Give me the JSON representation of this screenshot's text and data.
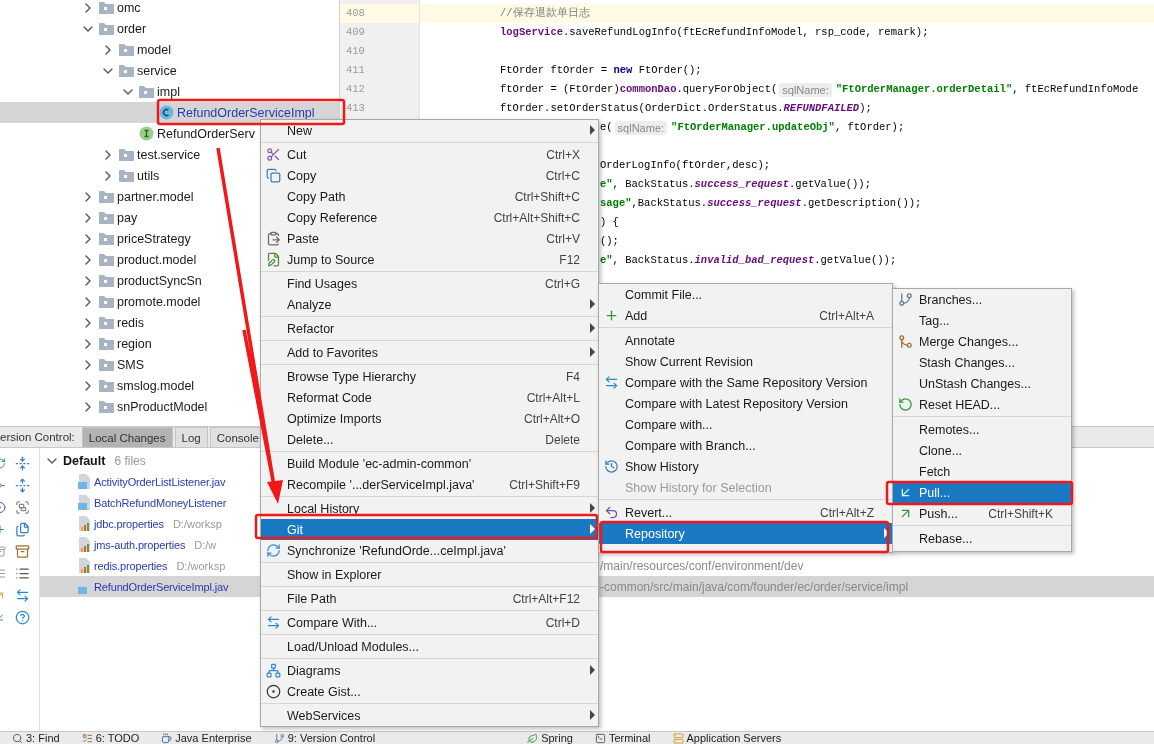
{
  "project_tree": {
    "items": [
      {
        "label": "omc",
        "kind": "folder",
        "expanded": false,
        "selected": false
      },
      {
        "label": "order",
        "kind": "folder",
        "expanded": true,
        "selected": false,
        "children": [
          {
            "label": "model",
            "kind": "folder",
            "expanded": false,
            "selected": false
          },
          {
            "label": "service",
            "kind": "folder",
            "expanded": true,
            "selected": false,
            "children": [
              {
                "label": "impl",
                "kind": "folder",
                "expanded": true,
                "selected": false,
                "children": [
                  {
                    "label": "RefundOrderServiceImpl",
                    "kind": "class",
                    "modified": true,
                    "selected": true
                  }
                ]
              },
              {
                "label": "RefundOrderServ",
                "kind": "interface",
                "modified": false,
                "selected": false
              }
            ]
          },
          {
            "label": "test.service",
            "kind": "folder",
            "expanded": false,
            "selected": false
          },
          {
            "label": "utils",
            "kind": "folder",
            "expanded": false,
            "selected": false
          }
        ]
      },
      {
        "label": "partner.model",
        "kind": "folder",
        "expanded": false,
        "selected": false
      },
      {
        "label": "pay",
        "kind": "folder",
        "expanded": false,
        "selected": false
      },
      {
        "label": "priceStrategy",
        "kind": "folder",
        "expanded": false,
        "selected": false
      },
      {
        "label": "product.model",
        "kind": "folder",
        "expanded": false,
        "selected": false
      },
      {
        "label": "productSyncSn",
        "kind": "folder",
        "expanded": false,
        "selected": false
      },
      {
        "label": "promote.model",
        "kind": "folder",
        "expanded": false,
        "selected": false
      },
      {
        "label": "redis",
        "kind": "folder",
        "expanded": false,
        "selected": false
      },
      {
        "label": "region",
        "kind": "folder",
        "expanded": false,
        "selected": false
      },
      {
        "label": "SMS",
        "kind": "folder",
        "expanded": false,
        "selected": false
      },
      {
        "label": "smslog.model",
        "kind": "folder",
        "expanded": false,
        "selected": false
      },
      {
        "label": "snProductModel",
        "kind": "folder",
        "expanded": false,
        "selected": false
      }
    ]
  },
  "editor": {
    "lines": [
      {
        "number": "408",
        "current": true,
        "tokens": [
          {
            "kind": "comment",
            "text": "//保存退款单日志"
          }
        ]
      },
      {
        "number": "409",
        "current": false,
        "tokens": [
          {
            "kind": "field",
            "text": "logService"
          },
          {
            "kind": "plain",
            "text": ".saveRefundLogInfo(ftEcRefundInfoModel, rsp_code, remark);"
          }
        ]
      },
      {
        "number": "410",
        "current": false
      },
      {
        "number": "411",
        "current": false,
        "tokens": [
          {
            "kind": "plain",
            "text": "FtOrder ftOrder = "
          },
          {
            "kind": "keyword",
            "text": "new"
          },
          {
            "kind": "plain",
            "text": " FtOrder();"
          }
        ]
      },
      {
        "number": "412",
        "current": false,
        "tokens": [
          {
            "kind": "plain",
            "text": "ftOrder = (FtOrder)"
          },
          {
            "kind": "field",
            "text": "commonDao"
          },
          {
            "kind": "plain",
            "text": ".queryForObject("
          },
          {
            "kind": "hint",
            "text": "sqlName:"
          },
          {
            "kind": "string",
            "text": "\"FtOrderManager.orderDetail\""
          },
          {
            "kind": "plain",
            "text": ", ftEcRefundInfoMode"
          }
        ]
      },
      {
        "number": "413",
        "current": false,
        "tokens": [
          {
            "kind": "plain",
            "text": "ftOrder.setOrderStatus(OrderDict.OrderStatus."
          },
          {
            "kind": "constant",
            "text": "REFUNDFAILED"
          },
          {
            "kind": "plain",
            "text": ");"
          }
        ]
      },
      {
        "current": false,
        "tokens": [
          {
            "kind": "plain",
            "text": "e("
          },
          {
            "kind": "hint",
            "text": "sqlName:"
          },
          {
            "kind": "string",
            "text": "\"FtOrderManager.updateObj\""
          },
          {
            "kind": "plain",
            "text": ", ftOrder);"
          }
        ]
      },
      {
        "current": false
      },
      {
        "current": false,
        "tokens": [
          {
            "kind": "plain",
            "text": "OrderLogInfo(ftOrder,desc);"
          }
        ]
      },
      {
        "current": false,
        "tokens": [
          {
            "kind": "string",
            "text": "e\""
          },
          {
            "kind": "plain",
            "text": ", BackStatus."
          },
          {
            "kind": "constant",
            "text": "success_request"
          },
          {
            "kind": "plain",
            "text": ".getValue());"
          }
        ]
      },
      {
        "current": false,
        "tokens": [
          {
            "kind": "string",
            "text": "sage\""
          },
          {
            "kind": "plain",
            "text": ",BackStatus."
          },
          {
            "kind": "constant",
            "text": "success_request"
          },
          {
            "kind": "plain",
            "text": ".getDescription());"
          }
        ]
      },
      {
        "current": false,
        "tokens": [
          {
            "kind": "plain",
            "text": ") {"
          }
        ]
      },
      {
        "current": false,
        "tokens": [
          {
            "kind": "plain",
            "text": "();"
          }
        ]
      },
      {
        "current": false,
        "tokens": [
          {
            "kind": "string",
            "text": "e\""
          },
          {
            "kind": "plain",
            "text": ", BackStatus."
          },
          {
            "kind": "constant",
            "text": "invalid_bad_request"
          },
          {
            "kind": "plain",
            "text": ".getValue());"
          }
        ]
      }
    ]
  },
  "version_control": {
    "title": "ersion Control:",
    "tabs": [
      {
        "label": "Local Changes",
        "selected": true
      },
      {
        "label": "Log",
        "selected": false
      },
      {
        "label": "Console",
        "selected": false
      }
    ],
    "changelist": {
      "name": "Default",
      "count": "6 files"
    },
    "files": [
      {
        "name": "ActivityOrderListListener.jav",
        "selected": false
      },
      {
        "name": "BatchRefundMoneyListener",
        "selected": false
      },
      {
        "name": "jdbc.properties",
        "path": "D:/worksp",
        "selected": false
      },
      {
        "name": "jms-auth.properties",
        "path": "D:/w",
        "selected": false
      },
      {
        "name": "redis.properties",
        "path": "D:/worksp",
        "path_end": "/main/resources/conf/environment/dev",
        "selected": false
      },
      {
        "name": "RefundOrderServiceImpl.jav",
        "path_end": "-common/src/main/java/com/founder/ec/order/service/impl",
        "selected": true
      }
    ]
  },
  "tool_bar": [
    "3: Find",
    "6: TODO",
    "Java Enterprise",
    "9: Version Control",
    "Spring",
    "Terminal",
    "Application Servers"
  ],
  "context_menu": {
    "items": [
      {
        "kind": "item",
        "label": "New",
        "submenu": true,
        "selected": false
      },
      {
        "kind": "separator"
      },
      {
        "kind": "item",
        "label": "Cut",
        "shortcut": "Ctrl+X",
        "selected": false
      },
      {
        "kind": "item",
        "label": "Copy",
        "shortcut": "Ctrl+C",
        "selected": false
      },
      {
        "kind": "item",
        "label": "Copy Path",
        "shortcut": "Ctrl+Shift+C",
        "selected": false
      },
      {
        "kind": "item",
        "label": "Copy Reference",
        "shortcut": "Ctrl+Alt+Shift+C",
        "selected": false
      },
      {
        "kind": "item",
        "label": "Paste",
        "shortcut": "Ctrl+V",
        "selected": false
      },
      {
        "kind": "item",
        "label": "Jump to Source",
        "shortcut": "F12",
        "selected": false
      },
      {
        "kind": "separator"
      },
      {
        "kind": "item",
        "label": "Find Usages",
        "shortcut": "Ctrl+G",
        "selected": false
      },
      {
        "kind": "item",
        "label": "Analyze",
        "submenu": true,
        "selected": false
      },
      {
        "kind": "separator"
      },
      {
        "kind": "item",
        "label": "Refactor",
        "submenu": true,
        "selected": false
      },
      {
        "kind": "separator"
      },
      {
        "kind": "item",
        "label": "Add to Favorites",
        "submenu": true,
        "selected": false
      },
      {
        "kind": "separator"
      },
      {
        "kind": "item",
        "label": "Browse Type Hierarchy",
        "shortcut": "F4",
        "selected": false
      },
      {
        "kind": "item",
        "label": "Reformat Code",
        "shortcut": "Ctrl+Alt+L",
        "selected": false
      },
      {
        "kind": "item",
        "label": "Optimize Imports",
        "shortcut": "Ctrl+Alt+O",
        "selected": false
      },
      {
        "kind": "item",
        "label": "Delete...",
        "shortcut": "Delete",
        "selected": false
      },
      {
        "kind": "separator"
      },
      {
        "kind": "item",
        "label": "Build Module 'ec-admin-common'",
        "selected": false
      },
      {
        "kind": "item",
        "label": "Recompile '...derServiceImpl.java'",
        "shortcut": "Ctrl+Shift+F9",
        "selected": false
      },
      {
        "kind": "separator"
      },
      {
        "kind": "item",
        "label": "Local History",
        "submenu": true,
        "selected": false
      },
      {
        "kind": "item",
        "label": "Git",
        "submenu": true,
        "selected": true
      },
      {
        "kind": "item",
        "label": "Synchronize 'RefundOrde...ceImpl.java'",
        "selected": false
      },
      {
        "kind": "separator"
      },
      {
        "kind": "item",
        "label": "Show in Explorer",
        "selected": false
      },
      {
        "kind": "separator"
      },
      {
        "kind": "item",
        "label": "File Path",
        "shortcut": "Ctrl+Alt+F12",
        "selected": false
      },
      {
        "kind": "separator"
      },
      {
        "kind": "item",
        "label": "Compare With...",
        "shortcut": "Ctrl+D",
        "selected": false
      },
      {
        "kind": "separator"
      },
      {
        "kind": "item",
        "label": "Load/Unload Modules...",
        "selected": false
      },
      {
        "kind": "separator"
      },
      {
        "kind": "item",
        "label": "Diagrams",
        "submenu": true,
        "selected": false
      },
      {
        "kind": "item",
        "label": "Create Gist...",
        "selected": false
      },
      {
        "kind": "separator"
      },
      {
        "kind": "item",
        "label": "WebServices",
        "submenu": true,
        "selected": false
      }
    ]
  },
  "git_submenu": {
    "items": [
      {
        "kind": "item",
        "label": "Commit File...",
        "selected": false,
        "disabled": false
      },
      {
        "kind": "item",
        "label": "Add",
        "shortcut": "Ctrl+Alt+A",
        "selected": false,
        "disabled": false
      },
      {
        "kind": "separator"
      },
      {
        "kind": "item",
        "label": "Annotate",
        "selected": false,
        "disabled": false
      },
      {
        "kind": "item",
        "label": "Show Current Revision",
        "selected": false,
        "disabled": false
      },
      {
        "kind": "item",
        "label": "Compare with the Same Repository Version",
        "selected": false,
        "disabled": false
      },
      {
        "kind": "item",
        "label": "Compare with Latest Repository Version",
        "selected": false,
        "disabled": false
      },
      {
        "kind": "item",
        "label": "Compare with...",
        "selected": false,
        "disabled": false
      },
      {
        "kind": "item",
        "label": "Compare with Branch...",
        "selected": false,
        "disabled": false
      },
      {
        "kind": "item",
        "label": "Show History",
        "selected": false,
        "disabled": false
      },
      {
        "kind": "item",
        "label": "Show History for Selection",
        "selected": false,
        "disabled": true
      },
      {
        "kind": "separator"
      },
      {
        "kind": "item",
        "label": "Revert...",
        "shortcut": "Ctrl+Alt+Z",
        "selected": false,
        "disabled": false
      },
      {
        "kind": "item",
        "label": "Repository",
        "submenu": true,
        "selected": true,
        "disabled": false
      }
    ]
  },
  "repository_submenu": {
    "items": [
      {
        "kind": "item",
        "label": "Branches...",
        "selected": false
      },
      {
        "kind": "item",
        "label": "Tag...",
        "selected": false
      },
      {
        "kind": "item",
        "label": "Merge Changes...",
        "selected": false
      },
      {
        "kind": "item",
        "label": "Stash Changes...",
        "selected": false
      },
      {
        "kind": "item",
        "label": "UnStash Changes...",
        "selected": false
      },
      {
        "kind": "item",
        "label": "Reset HEAD...",
        "selected": false
      },
      {
        "kind": "separator"
      },
      {
        "kind": "item",
        "label": "Remotes...",
        "selected": false
      },
      {
        "kind": "item",
        "label": "Clone...",
        "selected": false
      },
      {
        "kind": "item",
        "label": "Fetch",
        "selected": false
      },
      {
        "kind": "item",
        "label": "Pull...",
        "selected": true
      },
      {
        "kind": "item",
        "label": "Push...",
        "shortcut": "Ctrl+Shift+K",
        "selected": false
      },
      {
        "kind": "separator"
      },
      {
        "kind": "item",
        "label": "Rebase...",
        "selected": false
      }
    ]
  }
}
